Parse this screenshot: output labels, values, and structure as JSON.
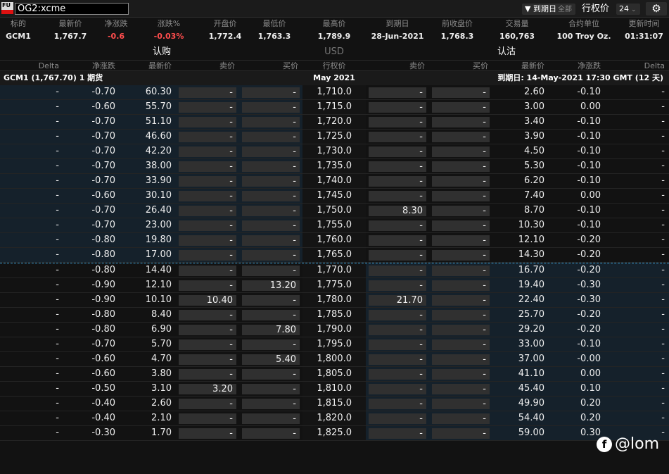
{
  "toolbar": {
    "logo": "FU",
    "symbol": "OG2:xcme",
    "expiry_filter_label": "到期日",
    "expiry_filter_value": "全部",
    "strikes_label": "行权价",
    "strikes_count": "24"
  },
  "stats": [
    {
      "h": "标的",
      "v": "GCM1"
    },
    {
      "h": "最新价",
      "v": "1,767.7"
    },
    {
      "h": "净涨跌",
      "v": "-0.6"
    },
    {
      "h": "涨跌%",
      "v": "-0.03%"
    },
    {
      "h": "开盘价",
      "v": "1,772.4"
    },
    {
      "h": "最低价",
      "v": "1,763.3"
    },
    {
      "h": "最高价",
      "v": "1,789.9"
    },
    {
      "h": "到期日",
      "v": "28-Jun-2021"
    },
    {
      "h": "前收盘价",
      "v": "1,768.3"
    },
    {
      "h": "交易量",
      "v": "160,763"
    },
    {
      "h": "合约单位",
      "v": "100 Troy Oz."
    },
    {
      "h": "更新时间",
      "v": "01:31:07"
    }
  ],
  "sides": {
    "calls": "认购",
    "currency": "USD",
    "puts": "认沽"
  },
  "columns": {
    "c_delta": "Delta",
    "c_chg": "净涨跌",
    "c_last": "最新价",
    "c_ask": "卖价",
    "c_bid": "买价",
    "strike": "行权价",
    "p_ask": "卖价",
    "p_bid": "买价",
    "p_last": "最新价",
    "p_chg": "净涨跌",
    "p_delta": "Delta"
  },
  "subheader": {
    "underlying": "GCM1 (1,767.70) 1 期货",
    "month": "May 2021",
    "expiry_info": "到期日: 14-May-2021 17:30 GMT (12 天)"
  },
  "rows": [
    {
      "cd": "-",
      "cc": "-0.70",
      "cl": "60.30",
      "ca": "-",
      "cb": "-",
      "k": "1,710.0",
      "pa": "-",
      "pb": "-",
      "pl": "2.60",
      "pc": "-0.10",
      "pd": "-"
    },
    {
      "cd": "-",
      "cc": "-0.60",
      "cl": "55.70",
      "ca": "-",
      "cb": "-",
      "k": "1,715.0",
      "pa": "-",
      "pb": "-",
      "pl": "3.00",
      "pc": "0.00",
      "pd": "-"
    },
    {
      "cd": "-",
      "cc": "-0.70",
      "cl": "51.10",
      "ca": "-",
      "cb": "-",
      "k": "1,720.0",
      "pa": "-",
      "pb": "-",
      "pl": "3.40",
      "pc": "-0.10",
      "pd": "-"
    },
    {
      "cd": "-",
      "cc": "-0.70",
      "cl": "46.60",
      "ca": "-",
      "cb": "-",
      "k": "1,725.0",
      "pa": "-",
      "pb": "-",
      "pl": "3.90",
      "pc": "-0.10",
      "pd": "-"
    },
    {
      "cd": "-",
      "cc": "-0.70",
      "cl": "42.20",
      "ca": "-",
      "cb": "-",
      "k": "1,730.0",
      "pa": "-",
      "pb": "-",
      "pl": "4.50",
      "pc": "-0.10",
      "pd": "-"
    },
    {
      "cd": "-",
      "cc": "-0.70",
      "cl": "38.00",
      "ca": "-",
      "cb": "-",
      "k": "1,735.0",
      "pa": "-",
      "pb": "-",
      "pl": "5.30",
      "pc": "-0.10",
      "pd": "-"
    },
    {
      "cd": "-",
      "cc": "-0.70",
      "cl": "33.90",
      "ca": "-",
      "cb": "-",
      "k": "1,740.0",
      "pa": "-",
      "pb": "-",
      "pl": "6.20",
      "pc": "-0.10",
      "pd": "-"
    },
    {
      "cd": "-",
      "cc": "-0.60",
      "cl": "30.10",
      "ca": "-",
      "cb": "-",
      "k": "1,745.0",
      "pa": "-",
      "pb": "-",
      "pl": "7.40",
      "pc": "0.00",
      "pd": "-"
    },
    {
      "cd": "-",
      "cc": "-0.70",
      "cl": "26.40",
      "ca": "-",
      "cb": "-",
      "k": "1,750.0",
      "pa": "8.30",
      "pb": "-",
      "pl": "8.70",
      "pc": "-0.10",
      "pd": "-"
    },
    {
      "cd": "-",
      "cc": "-0.70",
      "cl": "23.00",
      "ca": "-",
      "cb": "-",
      "k": "1,755.0",
      "pa": "-",
      "pb": "-",
      "pl": "10.30",
      "pc": "-0.10",
      "pd": "-"
    },
    {
      "cd": "-",
      "cc": "-0.80",
      "cl": "19.80",
      "ca": "-",
      "cb": "-",
      "k": "1,760.0",
      "pa": "-",
      "pb": "-",
      "pl": "12.10",
      "pc": "-0.20",
      "pd": "-"
    },
    {
      "cd": "-",
      "cc": "-0.80",
      "cl": "17.00",
      "ca": "-",
      "cb": "-",
      "k": "1,765.0",
      "pa": "-",
      "pb": "-",
      "pl": "14.30",
      "pc": "-0.20",
      "pd": "-"
    },
    {
      "cd": "-",
      "cc": "-0.80",
      "cl": "14.40",
      "ca": "-",
      "cb": "-",
      "k": "1,770.0",
      "pa": "-",
      "pb": "-",
      "pl": "16.70",
      "pc": "-0.20",
      "pd": "-"
    },
    {
      "cd": "-",
      "cc": "-0.90",
      "cl": "12.10",
      "ca": "-",
      "cb": "13.20",
      "k": "1,775.0",
      "pa": "-",
      "pb": "-",
      "pl": "19.40",
      "pc": "-0.30",
      "pd": "-"
    },
    {
      "cd": "-",
      "cc": "-0.90",
      "cl": "10.10",
      "ca": "10.40",
      "cb": "-",
      "k": "1,780.0",
      "pa": "21.70",
      "pb": "-",
      "pl": "22.40",
      "pc": "-0.30",
      "pd": "-"
    },
    {
      "cd": "-",
      "cc": "-0.80",
      "cl": "8.40",
      "ca": "-",
      "cb": "-",
      "k": "1,785.0",
      "pa": "-",
      "pb": "-",
      "pl": "25.70",
      "pc": "-0.20",
      "pd": "-"
    },
    {
      "cd": "-",
      "cc": "-0.80",
      "cl": "6.90",
      "ca": "-",
      "cb": "7.80",
      "k": "1,790.0",
      "pa": "-",
      "pb": "-",
      "pl": "29.20",
      "pc": "-0.20",
      "pd": "-"
    },
    {
      "cd": "-",
      "cc": "-0.70",
      "cl": "5.70",
      "ca": "-",
      "cb": "-",
      "k": "1,795.0",
      "pa": "-",
      "pb": "-",
      "pl": "33.00",
      "pc": "-0.10",
      "pd": "-"
    },
    {
      "cd": "-",
      "cc": "-0.60",
      "cl": "4.70",
      "ca": "-",
      "cb": "5.40",
      "k": "1,800.0",
      "pa": "-",
      "pb": "-",
      "pl": "37.00",
      "pc": "-0.00",
      "pd": "-"
    },
    {
      "cd": "-",
      "cc": "-0.60",
      "cl": "3.80",
      "ca": "-",
      "cb": "-",
      "k": "1,805.0",
      "pa": "-",
      "pb": "-",
      "pl": "41.10",
      "pc": "0.00",
      "pd": "-"
    },
    {
      "cd": "-",
      "cc": "-0.50",
      "cl": "3.10",
      "ca": "3.20",
      "cb": "-",
      "k": "1,810.0",
      "pa": "-",
      "pb": "-",
      "pl": "45.40",
      "pc": "0.10",
      "pd": "-"
    },
    {
      "cd": "-",
      "cc": "-0.40",
      "cl": "2.60",
      "ca": "-",
      "cb": "-",
      "k": "1,815.0",
      "pa": "-",
      "pb": "-",
      "pl": "49.90",
      "pc": "0.20",
      "pd": "-"
    },
    {
      "cd": "-",
      "cc": "-0.40",
      "cl": "2.10",
      "ca": "-",
      "cb": "-",
      "k": "1,820.0",
      "pa": "-",
      "pb": "-",
      "pl": "54.40",
      "pc": "0.20",
      "pd": "-"
    },
    {
      "cd": "-",
      "cc": "-0.30",
      "cl": "1.70",
      "ca": "-",
      "cb": "-",
      "k": "1,825.0",
      "pa": "-",
      "pb": "-",
      "pl": "59.00",
      "pc": "0.30",
      "pd": "-"
    }
  ],
  "watermark": "@lom"
}
